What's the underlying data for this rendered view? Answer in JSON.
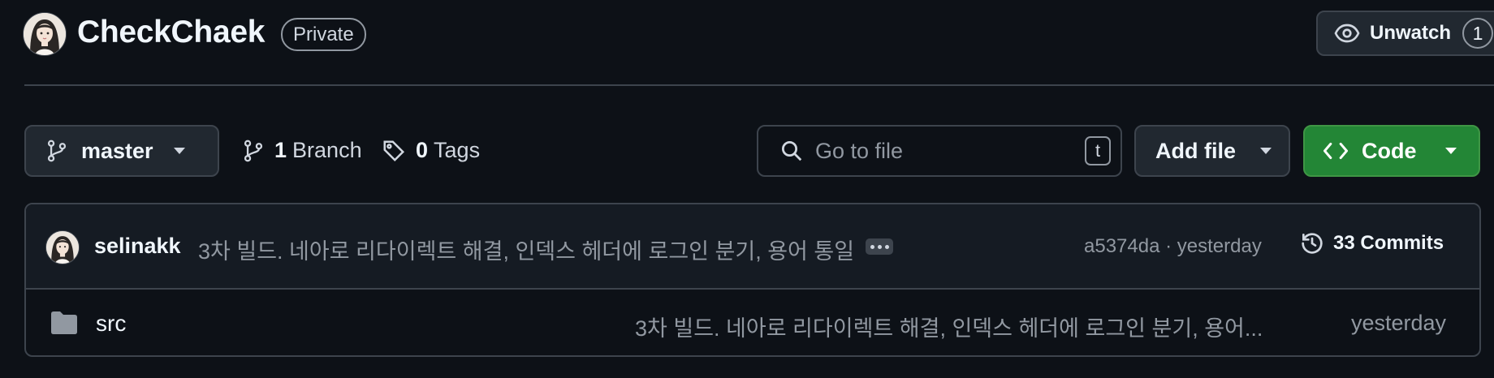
{
  "repo": {
    "name": "CheckChaek",
    "visibility": "Private",
    "unwatch_label": "Unwatch",
    "watch_count": "1"
  },
  "toolbar": {
    "branch": "master",
    "branch_count": "1",
    "branch_label": "Branch",
    "tag_count": "0",
    "tag_label": "Tags",
    "search_placeholder": "Go to file",
    "search_shortcut": "t",
    "add_file_label": "Add file",
    "code_label": "Code"
  },
  "latest_commit": {
    "author": "selinakk",
    "message": "3차 빌드. 네아로 리다이렉트 해결, 인덱스 헤더에 로그인 분기, 용어 통일",
    "hash_time": "a5374da · yesterday",
    "commits_label": "33 Commits"
  },
  "files": [
    {
      "name": "src",
      "type": "folder",
      "message": "3차 빌드. 네아로 리다이렉트 해결, 인덱스 헤더에 로그인 분기, 용어...",
      "date": "yesterday"
    }
  ],
  "colors": {
    "background": "#0d1117",
    "code_button": "#238636",
    "border": "#3d444d"
  },
  "icons": [
    "avatar",
    "eye-icon",
    "git-branch-icon",
    "tag-icon",
    "search-icon",
    "code-icon",
    "history-icon",
    "folder-icon"
  ]
}
